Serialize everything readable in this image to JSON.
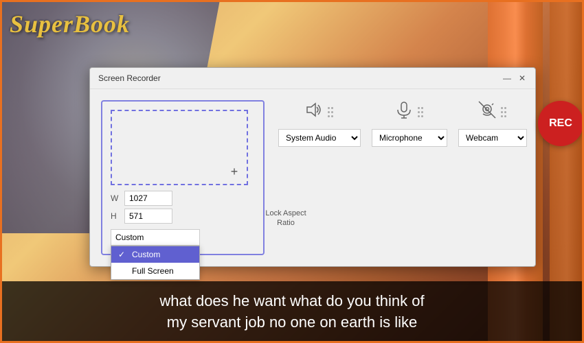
{
  "background": {
    "subtitle_line1": "what does he want what do you think of",
    "subtitle_line2": "my servant job no one on earth is like"
  },
  "logo": {
    "text": "SuperBook"
  },
  "dialog": {
    "title": "Screen Recorder",
    "minimize_label": "—",
    "close_label": "✕",
    "capture": {
      "width_label": "W",
      "height_label": "H",
      "width_value": "1027",
      "height_value": "571",
      "preset_selected": "Custom",
      "lock_aspect_label": "Lock Aspect\nRatio",
      "dropdown_items": [
        {
          "label": "Custom",
          "selected": true
        },
        {
          "label": "Full Screen",
          "selected": false
        }
      ]
    },
    "controls": {
      "audio_label": "System Audio",
      "mic_label": "Microphone",
      "webcam_label": "Webcam",
      "rec_label": "REC",
      "audio_options": [
        "System Audio"
      ],
      "mic_options": [
        "Microphone"
      ],
      "webcam_options": [
        "Webcam"
      ]
    }
  }
}
